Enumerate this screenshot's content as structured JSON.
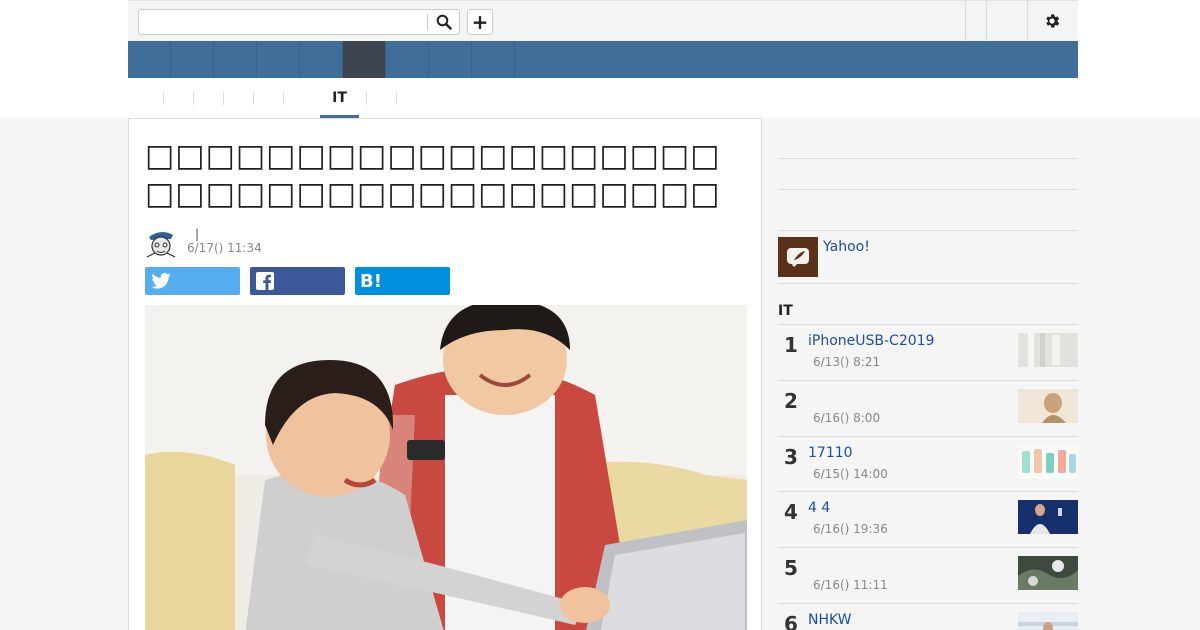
{
  "search": {
    "placeholder": "",
    "value": ""
  },
  "header": {
    "add_label": "+"
  },
  "subnav": {
    "active_label": "IT"
  },
  "article": {
    "title": "□□□□□□□□□□□□□□□□□□□□□□□□□□□□□□□□□□□□□□",
    "byline_separator": "|",
    "date": "6/17() 11:34",
    "share": {
      "hatena_label": "B!"
    }
  },
  "sidebar": {
    "yahoo_link": "Yahoo!",
    "ranking_title": "IT",
    "ranking": [
      {
        "rank": "1",
        "title": "iPhoneUSB-C2019",
        "date": "6/13() 8:21"
      },
      {
        "rank": "2",
        "title": "",
        "date": "6/16() 8:00"
      },
      {
        "rank": "3",
        "title": "17110",
        "date": "6/15() 14:00"
      },
      {
        "rank": "4",
        "title": "4 4",
        "date": "6/16() 19:36"
      },
      {
        "rank": "5",
        "title": "",
        "date": "6/16() 11:11"
      },
      {
        "rank": "6",
        "title": "NHKW",
        "date": ""
      }
    ]
  },
  "icons": {
    "search": "search-icon",
    "gear": "gear-icon",
    "twitter": "twitter-icon",
    "facebook": "facebook-icon"
  },
  "colors": {
    "nav_bg": "#3f6f99",
    "nav_active": "#3e4450",
    "link": "#1a4f9c",
    "twitter": "#55acee",
    "facebook": "#3b5998",
    "hatena": "#008fde"
  }
}
